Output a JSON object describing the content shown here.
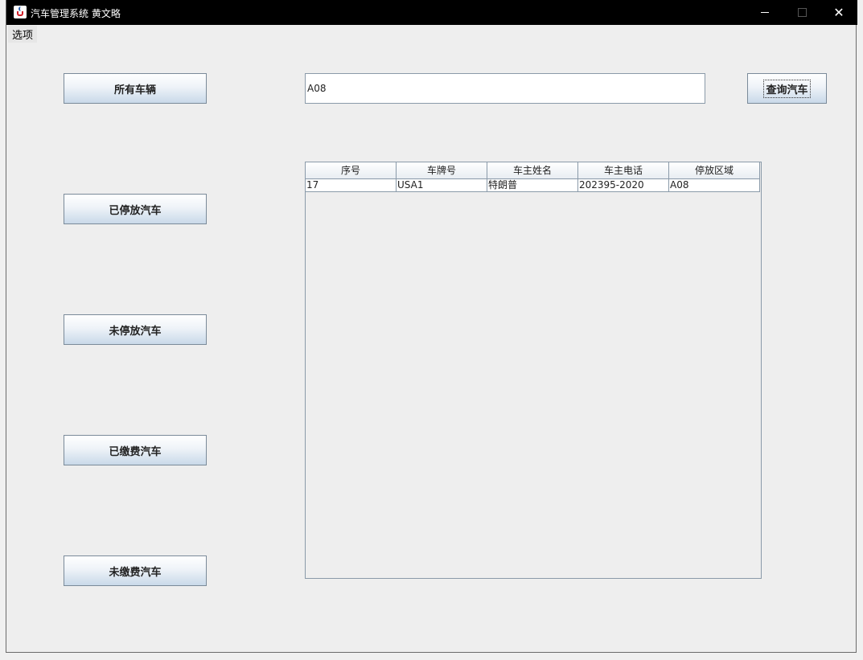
{
  "window": {
    "title": "汽车管理系统 黄文略"
  },
  "menubar": {
    "items": [
      "选项"
    ]
  },
  "sidebar": {
    "buttons": [
      "所有车辆",
      "已停放汽车",
      "未停放汽车",
      "已缴费汽车",
      "未缴费汽车"
    ]
  },
  "search": {
    "value": "A08",
    "button_label": "查询汽车"
  },
  "table": {
    "columns": [
      "序号",
      "车牌号",
      "车主姓名",
      "车主电话",
      "停放区域"
    ],
    "rows": [
      [
        "17",
        "USA1",
        "特朗普",
        "202395-2020",
        "A08"
      ]
    ]
  }
}
